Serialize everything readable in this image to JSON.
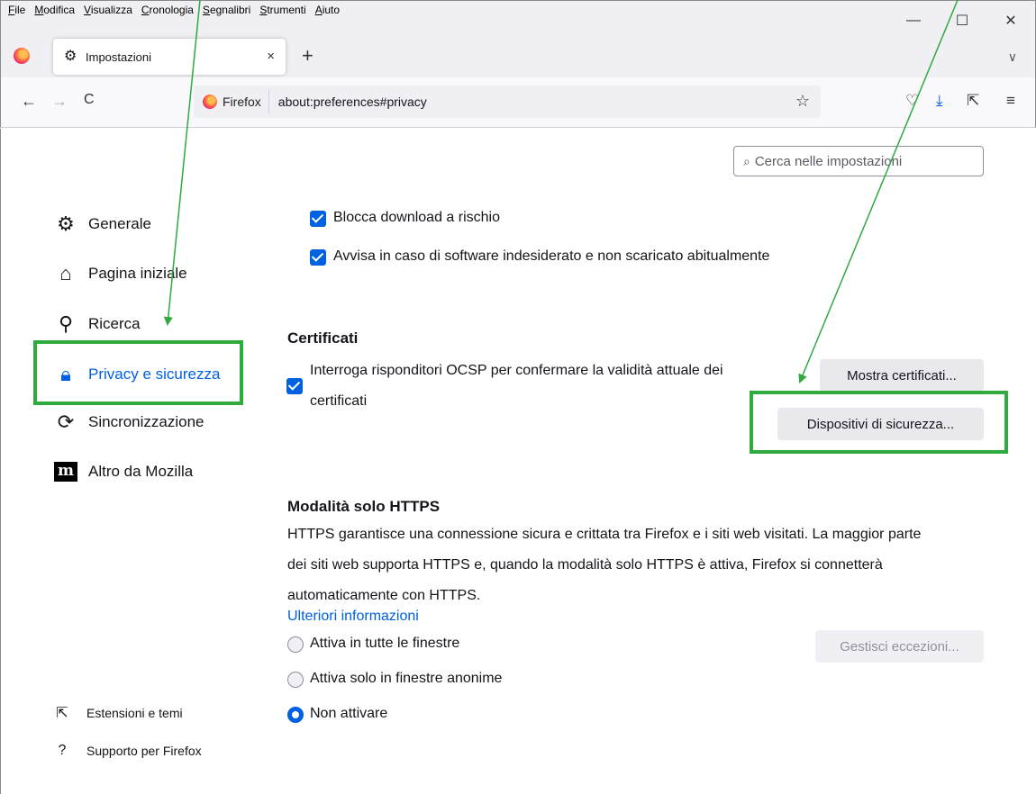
{
  "menubar": [
    "File",
    "Modifica",
    "Visualizza",
    "Cronologia",
    "Segnalibri",
    "Strumenti",
    "Aiuto"
  ],
  "window_controls": {
    "minimize": "—",
    "maximize": "☐",
    "close": "✕"
  },
  "tab": {
    "title": "Impostazioni",
    "close": "×",
    "new_tab": "+",
    "list_all": "∨"
  },
  "nav": {
    "back": "←",
    "forward": "→",
    "reload": "C"
  },
  "urlbar": {
    "identity": "Firefox",
    "url": "about:preferences#privacy",
    "bookmark_icon": "☆"
  },
  "toolbar_icons": {
    "pocket": "♡",
    "downloads": "⤓",
    "extensions": "⇱",
    "menu": "≡"
  },
  "search": {
    "placeholder": "Cerca nelle impostazioni",
    "icon": "⌕"
  },
  "sidebar": {
    "items": [
      {
        "label": "Generale",
        "icon": "gear-icon",
        "glyph": "⚙"
      },
      {
        "label": "Pagina iniziale",
        "icon": "home-icon",
        "glyph": "⌂"
      },
      {
        "label": "Ricerca",
        "icon": "search-icon",
        "glyph": "⚲"
      },
      {
        "label": "Privacy e sicurezza",
        "icon": "lock-icon",
        "glyph": "🔒︎"
      },
      {
        "label": "Sincronizzazione",
        "icon": "sync-icon",
        "glyph": "⟳"
      },
      {
        "label": "Altro da Mozilla",
        "icon": "mozilla-icon",
        "glyph": "m"
      }
    ],
    "footer": [
      {
        "label": "Estensioni e temi",
        "icon": "extensions-icon",
        "glyph": "⇱"
      },
      {
        "label": "Supporto per Firefox",
        "icon": "help-icon",
        "glyph": "?"
      }
    ]
  },
  "downloads_section": {
    "block_risky": "Blocca download a rischio",
    "warn_unwanted": "Avvisa in caso di software indesiderato e non scaricato abitualmente"
  },
  "certificates": {
    "heading": "Certificati",
    "ocsp_line1": "Interroga risponditori OCSP per confermare la validità attuale dei",
    "ocsp_line2": "certificati",
    "show_button": "Mostra certificati...",
    "devices_button": "Dispositivi di sicurezza..."
  },
  "https_only": {
    "heading": "Modalità solo HTTPS",
    "line1": "HTTPS garantisce una connessione sicura e crittata tra Firefox e i siti web visitati. La maggior parte",
    "line2": "dei siti web supporta HTTPS e, quando la modalità solo HTTPS è attiva, Firefox si connetterà",
    "line3": "automaticamente con HTTPS.",
    "learn_more": "Ulteriori informazioni",
    "options": [
      "Attiva in tutte le finestre",
      "Attiva solo in finestre anonime",
      "Non attivare"
    ],
    "selected": "Non attivare",
    "exceptions_button": "Gestisci eccezioni..."
  },
  "colors": {
    "accent": "#0061e0",
    "highlight": "#2eaa3e"
  }
}
